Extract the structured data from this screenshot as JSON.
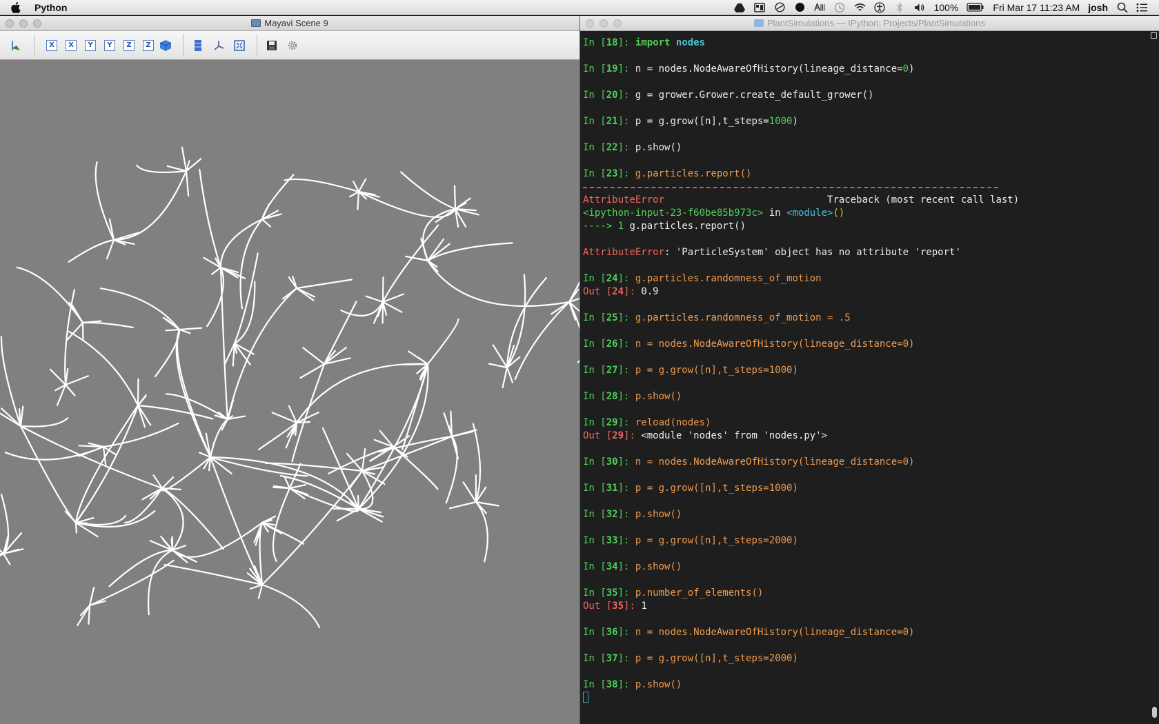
{
  "menubar": {
    "app_name": "Python",
    "battery": "100%",
    "clock": "Fri Mar 17  11:23 AM",
    "user": "josh",
    "icons": [
      "apple-icon",
      "drive-icon",
      "display-icon",
      "clock-icon",
      "timemachine-icon",
      "wifi-icon",
      "accessibility-icon",
      "bluetooth-icon",
      "volume-icon",
      "battery-icon",
      "spotlight-icon",
      "notification-icon"
    ]
  },
  "mayavi": {
    "title": "Mayavi Scene 9",
    "toolbar": {
      "axis_buttons": [
        "X",
        "X",
        "Y",
        "Y",
        "Z",
        "Z"
      ]
    }
  },
  "terminal": {
    "title": "PlantSimulations — IPython: Projects/PlantSimulations",
    "lines": [
      {
        "kind": "in",
        "n": "18",
        "parts": [
          {
            "t": "import",
            "c": "c-green bold"
          },
          {
            "t": " "
          },
          {
            "t": "nodes",
            "c": "c-cyan bold"
          }
        ]
      },
      {
        "kind": "blank"
      },
      {
        "kind": "in",
        "n": "19",
        "parts": [
          {
            "t": "n = nodes.NodeAwareOfHistory(lineage_distance="
          },
          {
            "t": "0",
            "c": "c-green"
          },
          {
            "t": ")"
          }
        ]
      },
      {
        "kind": "blank"
      },
      {
        "kind": "in",
        "n": "20",
        "parts": [
          {
            "t": "g = grower.Grower.create_default_grower()"
          }
        ]
      },
      {
        "kind": "blank"
      },
      {
        "kind": "in",
        "n": "21",
        "parts": [
          {
            "t": "p = g.grow([n],t_steps="
          },
          {
            "t": "1000",
            "c": "c-green"
          },
          {
            "t": ")"
          }
        ]
      },
      {
        "kind": "blank"
      },
      {
        "kind": "in",
        "n": "22",
        "parts": [
          {
            "t": "p.show()"
          }
        ]
      },
      {
        "kind": "blank"
      },
      {
        "kind": "in",
        "n": "23",
        "parts": [
          {
            "t": "g.particles.report()",
            "c": "c-orange"
          }
        ]
      },
      {
        "kind": "rule"
      },
      {
        "kind": "raw",
        "parts": [
          {
            "t": "AttributeError",
            "c": "c-red"
          },
          {
            "t": "                            Traceback (most recent call last)"
          }
        ]
      },
      {
        "kind": "raw",
        "parts": [
          {
            "t": "<ipython-input-23-f60be85b973c>",
            "c": "c-green"
          },
          {
            "t": " in "
          },
          {
            "t": "<module>",
            "c": "c-cyan"
          },
          {
            "t": "()",
            "c": "c-yellow"
          }
        ]
      },
      {
        "kind": "raw",
        "parts": [
          {
            "t": "----> 1 ",
            "c": "c-green"
          },
          {
            "t": "g.particles.report()"
          }
        ]
      },
      {
        "kind": "blank"
      },
      {
        "kind": "raw",
        "parts": [
          {
            "t": "AttributeError",
            "c": "c-red"
          },
          {
            "t": ": 'ParticleSystem' object has no attribute 'report'"
          }
        ]
      },
      {
        "kind": "blank"
      },
      {
        "kind": "in",
        "n": "24",
        "parts": [
          {
            "t": "g.particles.randomness_of_motion",
            "c": "c-orange"
          }
        ]
      },
      {
        "kind": "out",
        "n": "24",
        "parts": [
          {
            "t": "0.9"
          }
        ]
      },
      {
        "kind": "blank"
      },
      {
        "kind": "in",
        "n": "25",
        "parts": [
          {
            "t": "g.particles.randomness_of_motion = .5",
            "c": "c-orange"
          }
        ]
      },
      {
        "kind": "blank"
      },
      {
        "kind": "in",
        "n": "26",
        "parts": [
          {
            "t": "n = nodes.NodeAwareOfHistory(lineage_distance=0)",
            "c": "c-orange"
          }
        ]
      },
      {
        "kind": "blank"
      },
      {
        "kind": "in",
        "n": "27",
        "parts": [
          {
            "t": "p = g.grow([n],t_steps=1000)",
            "c": "c-orange"
          }
        ]
      },
      {
        "kind": "blank"
      },
      {
        "kind": "in",
        "n": "28",
        "parts": [
          {
            "t": "p.show()",
            "c": "c-orange"
          }
        ]
      },
      {
        "kind": "blank"
      },
      {
        "kind": "in",
        "n": "29",
        "parts": [
          {
            "t": "reload(nodes)",
            "c": "c-orange"
          }
        ]
      },
      {
        "kind": "out",
        "n": "29",
        "parts": [
          {
            "t": "<module 'nodes' from 'nodes.py'>"
          }
        ]
      },
      {
        "kind": "blank"
      },
      {
        "kind": "in",
        "n": "30",
        "parts": [
          {
            "t": "n = nodes.NodeAwareOfHistory(lineage_distance=0)",
            "c": "c-orange"
          }
        ]
      },
      {
        "kind": "blank"
      },
      {
        "kind": "in",
        "n": "31",
        "parts": [
          {
            "t": "p = g.grow([n],t_steps=1000)",
            "c": "c-orange"
          }
        ]
      },
      {
        "kind": "blank"
      },
      {
        "kind": "in",
        "n": "32",
        "parts": [
          {
            "t": "p.show()",
            "c": "c-orange"
          }
        ]
      },
      {
        "kind": "blank"
      },
      {
        "kind": "in",
        "n": "33",
        "parts": [
          {
            "t": "p = g.grow([n],t_steps=2000)",
            "c": "c-orange"
          }
        ]
      },
      {
        "kind": "blank"
      },
      {
        "kind": "in",
        "n": "34",
        "parts": [
          {
            "t": "p.show()",
            "c": "c-orange"
          }
        ]
      },
      {
        "kind": "blank"
      },
      {
        "kind": "in",
        "n": "35",
        "parts": [
          {
            "t": "p.number_of_elements()",
            "c": "c-orange"
          }
        ]
      },
      {
        "kind": "out",
        "n": "35",
        "parts": [
          {
            "t": "1"
          }
        ]
      },
      {
        "kind": "blank"
      },
      {
        "kind": "in",
        "n": "36",
        "parts": [
          {
            "t": "n = nodes.NodeAwareOfHistory(lineage_distance=0)",
            "c": "c-orange"
          }
        ]
      },
      {
        "kind": "blank"
      },
      {
        "kind": "in",
        "n": "37",
        "parts": [
          {
            "t": "p = g.grow([n],t_steps=2000)",
            "c": "c-orange"
          }
        ]
      },
      {
        "kind": "blank"
      },
      {
        "kind": "in",
        "n": "38",
        "parts": [
          {
            "t": "p.show()",
            "c": "c-orange"
          }
        ]
      },
      {
        "kind": "cursor"
      }
    ]
  },
  "colors": {
    "prompt_in": "#4fd15a",
    "prompt_out": "#f0665f",
    "history_text": "#ef9a4e",
    "scene_bg": "#808080",
    "terminal_bg": "#1e1e1e"
  }
}
